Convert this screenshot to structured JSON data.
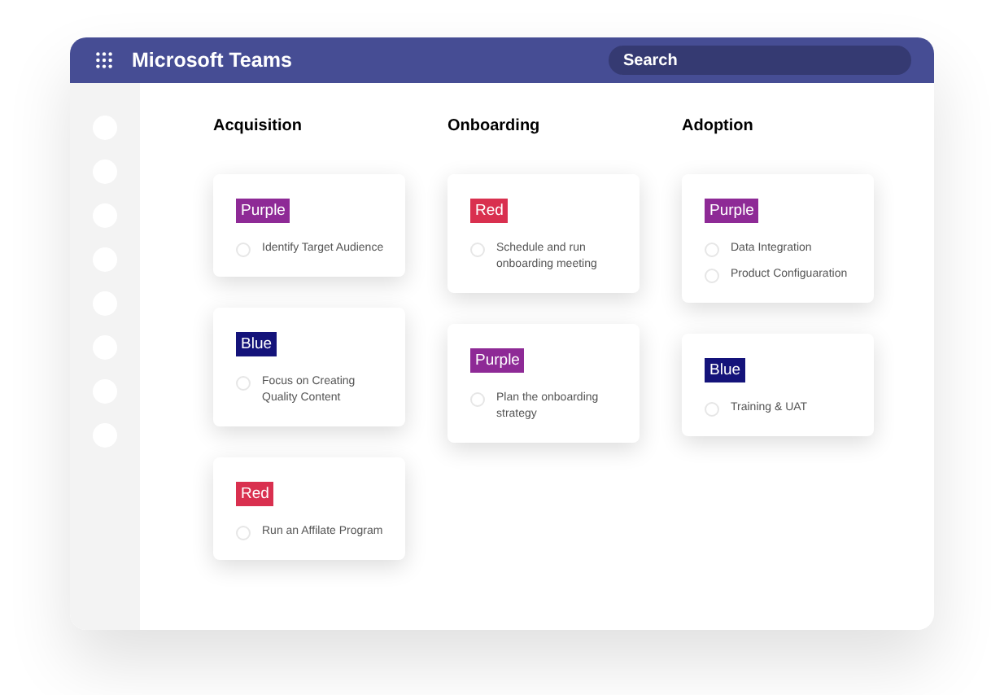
{
  "window": {
    "title": "Microsoft Teams"
  },
  "search": {
    "placeholder": "Search"
  },
  "columns": [
    {
      "title": "Acquisition",
      "cards": [
        {
          "tag": {
            "label": "Purple",
            "color": "#8e2a96"
          },
          "tasks": [
            {
              "text": "Identify Target Audience",
              "checked": false
            }
          ]
        },
        {
          "tag": {
            "label": "Blue",
            "color": "#14137a"
          },
          "tasks": [
            {
              "text": "Focus on Creating Quality Content",
              "checked": false
            }
          ]
        },
        {
          "tag": {
            "label": "Red",
            "color": "#d9304f"
          },
          "tasks": [
            {
              "text": "Run an Affilate Program",
              "checked": false
            }
          ]
        }
      ]
    },
    {
      "title": "Onboarding",
      "cards": [
        {
          "tag": {
            "label": "Red",
            "color": "#d9304f"
          },
          "tasks": [
            {
              "text": "Schedule and run onboarding meeting",
              "checked": false
            }
          ]
        },
        {
          "tag": {
            "label": "Purple",
            "color": "#8e2a96"
          },
          "tasks": [
            {
              "text": "Plan the onboarding strategy",
              "checked": false
            }
          ]
        }
      ]
    },
    {
      "title": "Adoption",
      "cards": [
        {
          "tag": {
            "label": "Purple",
            "color": "#8e2a96"
          },
          "tasks": [
            {
              "text": "Data Integration",
              "checked": false
            },
            {
              "text": "Product Configuaration",
              "checked": false
            }
          ]
        },
        {
          "tag": {
            "label": "Blue",
            "color": "#14137a"
          },
          "tasks": [
            {
              "text": "Training & UAT",
              "checked": false
            }
          ]
        }
      ]
    }
  ]
}
